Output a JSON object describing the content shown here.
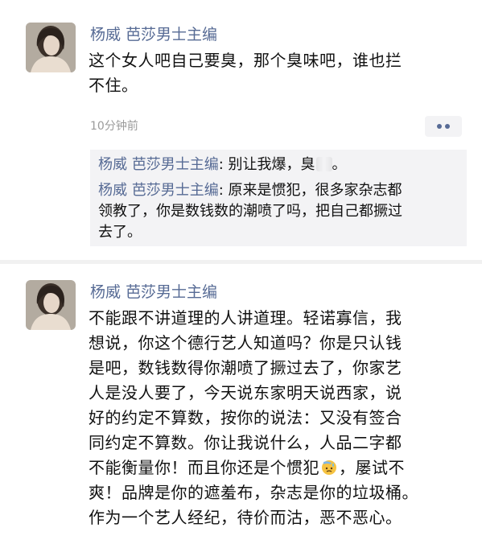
{
  "post1": {
    "author": "杨威 芭莎男士主编",
    "text_lines": [
      "这个女人吧自己要臭，那个臭味吧，谁也拦",
      "不住。"
    ],
    "time": "10分钟前",
    "comments": [
      {
        "author": "杨威 芭莎男士主编",
        "text_before": "别让我爆，臭",
        "text_after": "。"
      },
      {
        "author": "杨威 芭莎男士主编",
        "text_lines": [
          "原来是惯犯，很多家杂志都",
          "领教了，你是数钱数的潮喷了吗，把自己都撅过",
          "去了。"
        ]
      }
    ]
  },
  "post2": {
    "author": "杨威 芭莎男士主编",
    "text_lines": [
      "不能跟不讲道理的人讲道理。轻诺寡信，我",
      "想说，你这个德行艺人知道吗？你是只认钱",
      "是吧，数钱数得你潮喷了撅过去了，你家艺",
      "人是没人要了，今天说东家明天说西家，说",
      "好的约定不算数，按你的说法：又没有签合",
      "同约定不算数。你让我说什么，人品二字都"
    ],
    "line7_before": "不能衡量你！而且你还是个惯犯",
    "line7_after": "，屡试不",
    "text_lines_end": [
      "爽！品牌是你的遮羞布，杂志是你的垃圾桶。",
      "作为一个艺人经纪，待价而沽，恶不恶心。"
    ]
  },
  "colors": {
    "name_link": "#576b95",
    "comment_bg": "#f3f3f5",
    "divider": "#f1f1f1",
    "time_gray": "#9b9b9b"
  },
  "icons": {
    "more": "more-dots-icon",
    "emoji": "sweat-emoji-icon"
  }
}
